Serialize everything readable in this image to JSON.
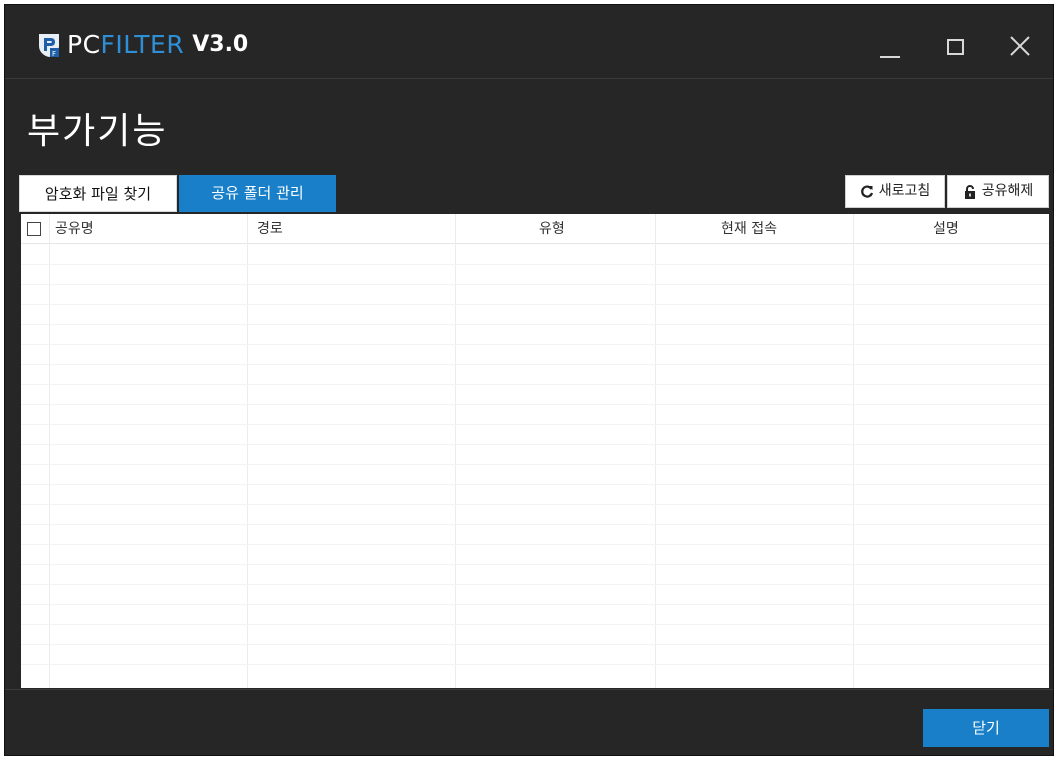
{
  "app": {
    "logo_pc": "PC",
    "logo_filter": "FILTER",
    "version": "V3.0",
    "accent_color": "#1a7fc9"
  },
  "window_controls": {
    "minimize_icon": "minimize-icon",
    "maximize_icon": "maximize-icon",
    "close_icon": "close-icon"
  },
  "page_title": "부가기능",
  "tabs": [
    {
      "label": "암호화 파일 찾기",
      "active": false
    },
    {
      "label": "공유 폴더 관리",
      "active": true
    }
  ],
  "toolbar": {
    "refresh_label": "새로고침",
    "refresh_icon": "refresh-icon",
    "unshare_label": "공유해제",
    "unshare_icon": "unlock-icon"
  },
  "table": {
    "columns": [
      "공유명",
      "경로",
      "유형",
      "현재 접속",
      "설명"
    ],
    "rows": []
  },
  "footer": {
    "close_label": "닫기"
  }
}
